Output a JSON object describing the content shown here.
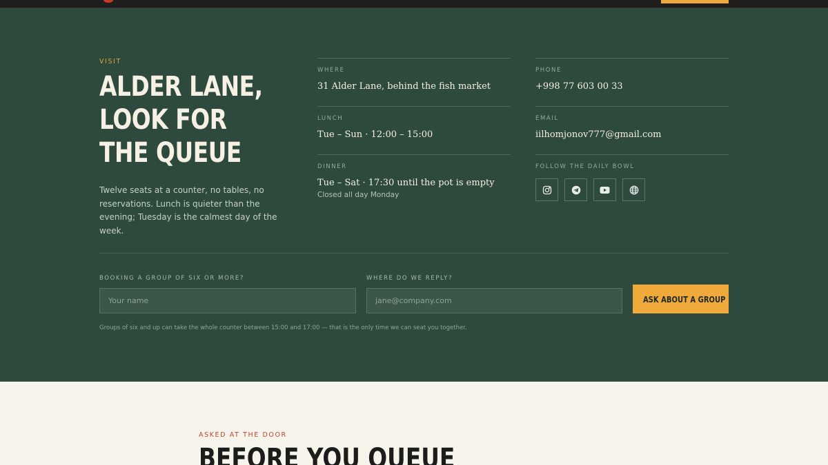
{
  "colors": {
    "panel": "#2e4a3d",
    "accent": "#f0a93b",
    "cream": "#f7f4ec",
    "faq_eyebrow": "#c0442f"
  },
  "visit": {
    "eyebrow": "VISIT",
    "headline_lines": [
      "ALDER LANE,",
      "LOOK FOR",
      "THE QUEUE"
    ],
    "intro": "Twelve seats at a counter, no tables, no reservations. Lunch is quieter than the evening; Tuesday is the calmest day of the week.",
    "where": {
      "label": "WHERE",
      "value": "31 Alder Lane, behind the fish market"
    },
    "lunch": {
      "label": "LUNCH",
      "value": "Tue – Sun · 12:00 – 15:00"
    },
    "dinner": {
      "label": "DINNER",
      "value": "Tue – Sat · 17:30 until the pot is empty",
      "note": "Closed all day Monday"
    },
    "phone": {
      "label": "PHONE",
      "value": "+998 77 603 00 33"
    },
    "email": {
      "label": "EMAIL",
      "value": "iilhomjonov777@gmail.com"
    },
    "follow": {
      "label": "FOLLOW THE DAILY BOWL",
      "icons": [
        "instagram-icon",
        "telegram-icon",
        "youtube-icon",
        "globe-icon"
      ]
    }
  },
  "group_form": {
    "name_label": "BOOKING A GROUP OF SIX OR MORE?",
    "name_placeholder": "Your name",
    "email_label": "WHERE DO WE REPLY?",
    "email_placeholder": "jane@company.com",
    "button": "ASK ABOUT A GROUP",
    "fine_print": "Groups of six and up can take the whole counter between 15:00 and 17:00 — that is the only time we can seat you together."
  },
  "faq": {
    "eyebrow": "ASKED AT THE DOOR",
    "title": "BEFORE YOU QUEUE"
  }
}
